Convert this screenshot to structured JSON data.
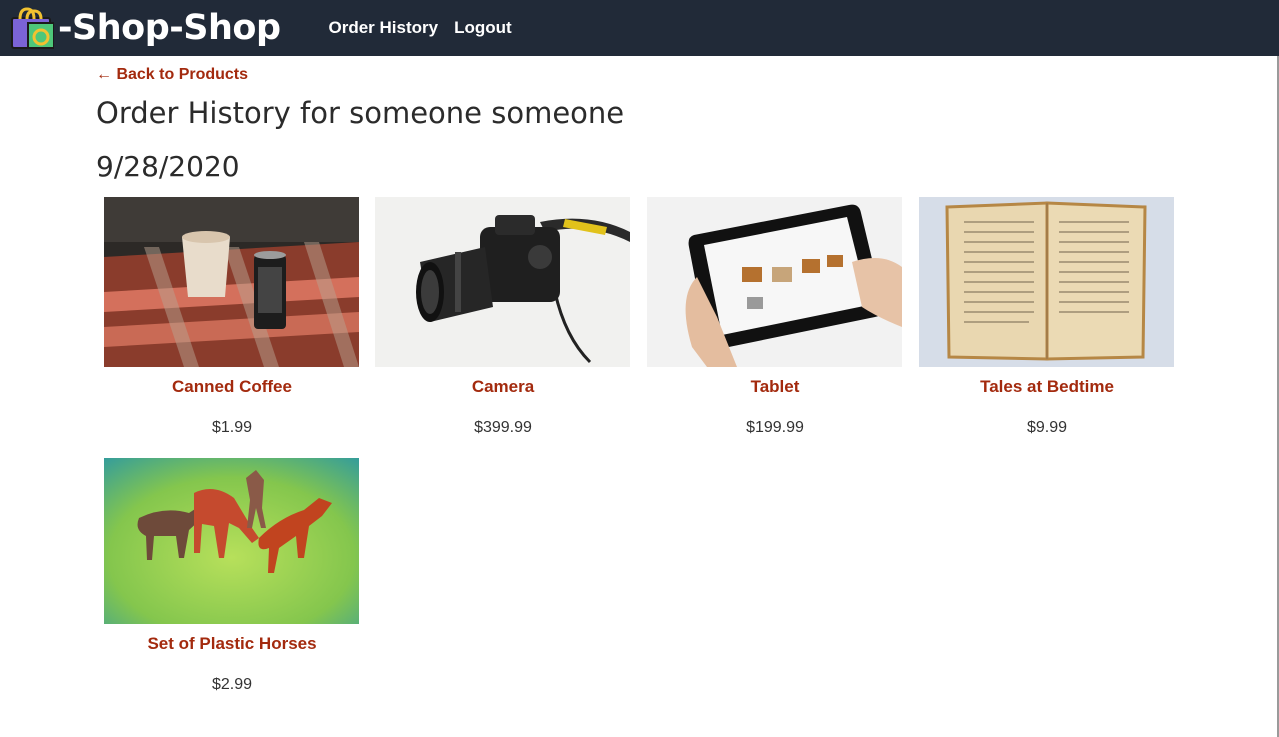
{
  "navbar": {
    "brand": "-Shop-Shop",
    "logo_icon": "shopping-bag-icon",
    "links": [
      "Order History",
      "Logout"
    ]
  },
  "back_link": "← Back to Products",
  "page_title": "Order History for someone someone",
  "order": {
    "date": "9/28/2020",
    "products": [
      {
        "name": "Canned Coffee",
        "price": "$1.99",
        "image": "canned-coffee-photo"
      },
      {
        "name": "Camera",
        "price": "$399.99",
        "image": "camera-photo"
      },
      {
        "name": "Tablet",
        "price": "$199.99",
        "image": "tablet-photo"
      },
      {
        "name": "Tales at Bedtime",
        "price": "$9.99",
        "image": "open-book-photo"
      },
      {
        "name": "Set of Plastic Horses",
        "price": "$2.99",
        "image": "plastic-horses-photo"
      }
    ]
  },
  "colors": {
    "navbar_bg": "#212a38",
    "link_accent": "#a32a0e"
  }
}
